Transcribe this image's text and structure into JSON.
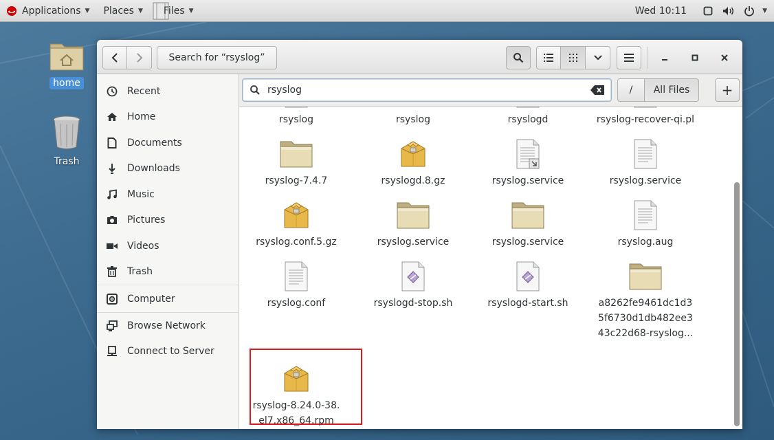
{
  "topbar": {
    "applications": "Applications",
    "places": "Places",
    "files": "Files",
    "clock": "Wed 10:11"
  },
  "desktop": {
    "home_label": "home",
    "trash_label": "Trash"
  },
  "header": {
    "path_button": "Search for “rsyslog”"
  },
  "sidebar": {
    "items": [
      {
        "label": "Recent",
        "icon": "clock-icon"
      },
      {
        "label": "Home",
        "icon": "home-icon"
      },
      {
        "label": "Documents",
        "icon": "document-icon"
      },
      {
        "label": "Downloads",
        "icon": "download-icon"
      },
      {
        "label": "Music",
        "icon": "music-icon"
      },
      {
        "label": "Pictures",
        "icon": "camera-icon"
      },
      {
        "label": "Videos",
        "icon": "video-icon"
      },
      {
        "label": "Trash",
        "icon": "trash-icon"
      },
      {
        "label": "Computer",
        "icon": "computer-icon"
      },
      {
        "label": "Browse Network",
        "icon": "network-icon"
      },
      {
        "label": "Connect to Server",
        "icon": "server-icon"
      }
    ]
  },
  "search": {
    "query": "rsyslog",
    "location_button": "/",
    "scope_button": "All Files",
    "add_button": "+"
  },
  "files": [
    {
      "name": "rsyslog",
      "type": "text"
    },
    {
      "name": "rsyslog",
      "type": "folder"
    },
    {
      "name": "rsyslogd",
      "type": "text"
    },
    {
      "name": "rsyslog-recover-qi.pl",
      "type": "text"
    },
    {
      "name": "rsyslog-7.4.7",
      "type": "folder"
    },
    {
      "name": "rsyslogd.8.gz",
      "type": "archive"
    },
    {
      "name": "rsyslog.service",
      "type": "link"
    },
    {
      "name": "rsyslog.service",
      "type": "text"
    },
    {
      "name": "rsyslog.conf.5.gz",
      "type": "archive"
    },
    {
      "name": "rsyslog.service",
      "type": "folder"
    },
    {
      "name": "rsyslog.service",
      "type": "folder"
    },
    {
      "name": "rsyslog.aug",
      "type": "text"
    },
    {
      "name": "rsyslog.conf",
      "type": "text"
    },
    {
      "name": "rsyslogd-stop.sh",
      "type": "script"
    },
    {
      "name": "rsyslogd-start.sh",
      "type": "script"
    },
    {
      "name_lines": [
        "a8262fe9461dc1d3",
        "5f6730d1db482ee3",
        "43c22d68-rsyslog..."
      ],
      "type": "folder"
    },
    {
      "name_lines": [
        "rsyslog-8.24.0-38.",
        "el7.x86_64.rpm"
      ],
      "type": "archive",
      "highlighted": true
    }
  ]
}
